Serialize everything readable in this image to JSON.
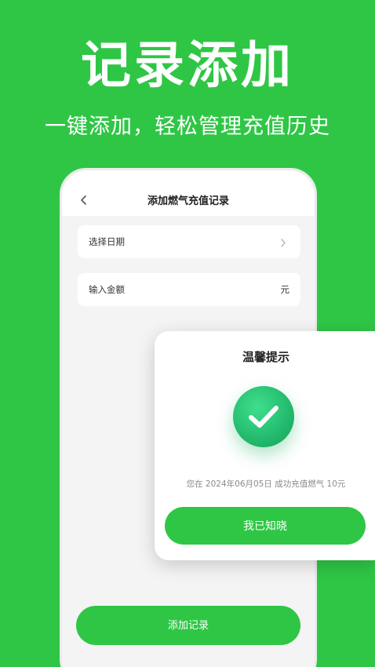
{
  "hero": {
    "title": "记录添加",
    "subtitle": "一键添加，轻松管理充值历史"
  },
  "app": {
    "header_title": "添加燃气充值记录",
    "fields": [
      {
        "label": "选择日期",
        "trailing": "chevron-right-icon"
      },
      {
        "label": "输入金额",
        "unit": "元"
      }
    ],
    "add_button_label": "添加记录"
  },
  "dialog": {
    "title": "温馨提示",
    "icon": "checkmark-icon",
    "message": "您在 2024年06月05日 成功充值燃气 10元",
    "confirm_label": "我已知晓"
  },
  "colors": {
    "brand_green": "#2fc646",
    "success_green": "#1fb368",
    "background_gray": "#f4f4f4"
  }
}
